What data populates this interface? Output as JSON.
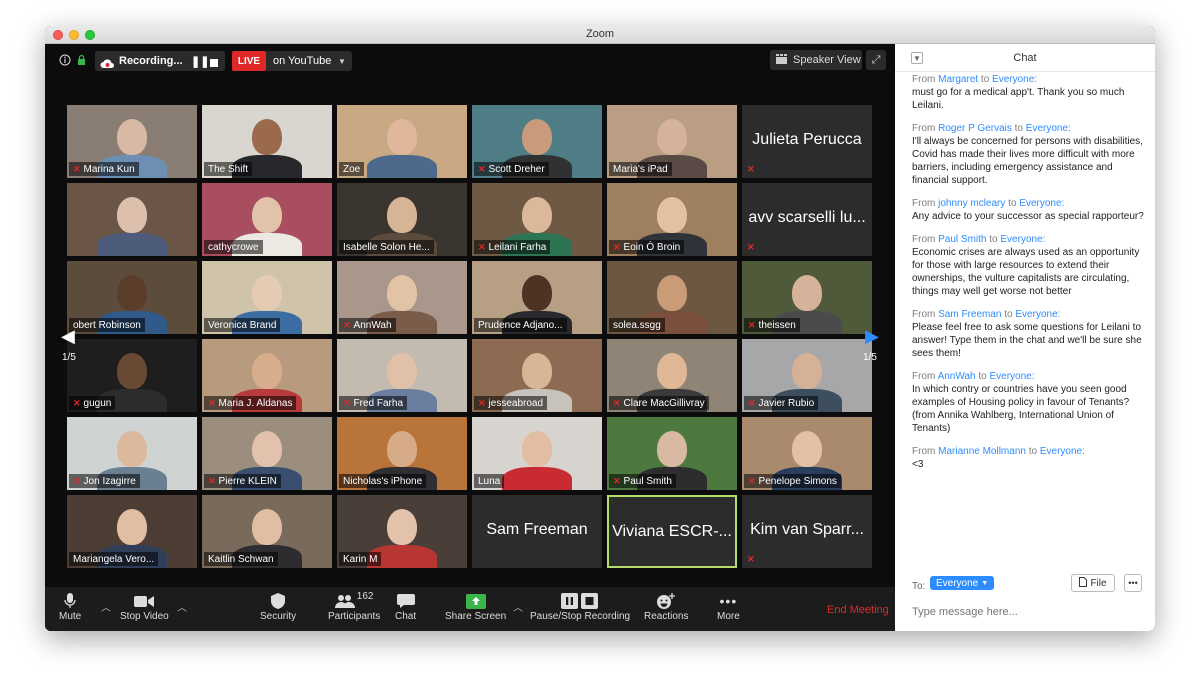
{
  "window": {
    "title": "Zoom"
  },
  "topbar": {
    "recording_label": "Recording...",
    "live_label": "LIVE",
    "youtube_label": "on YouTube",
    "speaker_view_label": "Speaker View"
  },
  "gallery": {
    "page_indicator_left": "1/5",
    "page_indicator_right": "1/5",
    "participants": [
      {
        "name": "Marina Kun",
        "muted": true,
        "video": true,
        "bg": "#8a7d74",
        "skin": "#d7b9a6",
        "shirt": "#6d8fb3"
      },
      {
        "name": "The Shift",
        "muted": false,
        "video": true,
        "bg": "#d9d6cf",
        "skin": "#9b6a4c",
        "shirt": "#27282b"
      },
      {
        "name": "Zoe",
        "muted": false,
        "video": true,
        "bg": "#c9a884",
        "skin": "#e0b79a",
        "shirt": "#4d6a8d"
      },
      {
        "name": "Scott Dreher",
        "muted": true,
        "video": true,
        "bg": "#4f7d86",
        "skin": "#c99b7b",
        "shirt": "#2f3133"
      },
      {
        "name": "Maria's iPad",
        "muted": false,
        "video": true,
        "bg": "#b99e84",
        "skin": "#d4b29b",
        "shirt": "#5a4a46"
      },
      {
        "name": "Julieta Perucca",
        "muted": true,
        "video": false
      },
      {
        "name": "",
        "muted": false,
        "video": true,
        "bg": "#6b5547",
        "skin": "#dcc0ad",
        "shirt": "#4c5c7a"
      },
      {
        "name": "cathycrowe",
        "muted": false,
        "video": true,
        "bg": "#a84e5e",
        "skin": "#e2c2a8",
        "shirt": "#ece8e2"
      },
      {
        "name": "Isabelle Solon He...",
        "muted": false,
        "video": true,
        "bg": "#3b3530",
        "skin": "#d6b597",
        "shirt": "#5b4b3c"
      },
      {
        "name": "Leilani Farha",
        "muted": true,
        "video": true,
        "bg": "#6e5a44",
        "skin": "#dcb89a",
        "shirt": "#2d7552"
      },
      {
        "name": "Eoin Ó Broin",
        "muted": true,
        "video": true,
        "bg": "#9e7f5e",
        "skin": "#e2c0a1",
        "shirt": "#30333a"
      },
      {
        "name": "avv scarselli lu...",
        "muted": true,
        "video": false
      },
      {
        "name": "obert Robinson",
        "muted": false,
        "video": true,
        "bg": "#5c4c3c",
        "skin": "#5a3d2b",
        "shirt": "#2f5a8a"
      },
      {
        "name": "Veronica Brand",
        "muted": false,
        "video": true,
        "bg": "#cfc3aa",
        "skin": "#e6cbb4",
        "shirt": "#3c6da2"
      },
      {
        "name": "AnnWah",
        "muted": true,
        "video": true,
        "bg": "#a8978a",
        "skin": "#e2c3a6",
        "shirt": "#7a5c4a"
      },
      {
        "name": "Prudence Adjano...",
        "muted": false,
        "video": true,
        "bg": "#b69f83",
        "skin": "#4c3324",
        "shirt": "#2a2a2e"
      },
      {
        "name": "solea.ssgg",
        "muted": false,
        "video": true,
        "bg": "#6c5842",
        "skin": "#c99b77",
        "shirt": "#7c4e3c"
      },
      {
        "name": "theissen",
        "muted": true,
        "video": true,
        "bg": "#4e5a3a",
        "skin": "#d7b29a",
        "shirt": "#4b4b4b"
      },
      {
        "name": "gugun",
        "muted": true,
        "video": true,
        "bg": "#1e1e1e",
        "skin": "#6b4a35",
        "shirt": "#2c2c2c"
      },
      {
        "name": "Maria J. Aldanas",
        "muted": true,
        "video": true,
        "bg": "#b89b7e",
        "skin": "#d8ad8c",
        "shirt": "#b93a3a"
      },
      {
        "name": "Fred Farha",
        "muted": true,
        "video": true,
        "bg": "#c4bbb0",
        "skin": "#e0c0a8",
        "shirt": "#6a7ea0"
      },
      {
        "name": "jesseabroad",
        "muted": true,
        "video": true,
        "bg": "#8d6b52",
        "skin": "#d9b597",
        "shirt": "#c7c2bb"
      },
      {
        "name": "Clare MacGillivray",
        "muted": true,
        "video": true,
        "bg": "#8f8476",
        "skin": "#e0b895",
        "shirt": "#3a3a3a"
      },
      {
        "name": "Javier Rubio",
        "muted": true,
        "video": true,
        "bg": "#a7a7a9",
        "skin": "#d5b197",
        "shirt": "#3d4e5f"
      },
      {
        "name": "Jon Izagirre",
        "muted": true,
        "video": true,
        "bg": "#cfd3d1",
        "skin": "#dcb89d",
        "shirt": "#6a7f92"
      },
      {
        "name": "Pierre KLEIN",
        "muted": true,
        "video": true,
        "bg": "#9b8e7e",
        "skin": "#e2c2ac",
        "shirt": "#3a4f70"
      },
      {
        "name": "Nicholas's iPhone",
        "muted": false,
        "video": true,
        "bg": "#b9743a",
        "skin": "#d8ab88",
        "shirt": "#2f2f33"
      },
      {
        "name": "Luna",
        "muted": false,
        "video": true,
        "bg": "#d7d4d0",
        "skin": "#e2bda4",
        "shirt": "#c92b33"
      },
      {
        "name": "Paul Smith",
        "muted": true,
        "video": true,
        "bg": "#4c7a3e",
        "skin": "#d9b9a1",
        "shirt": "#2d2d2f"
      },
      {
        "name": "Penelope Simons",
        "muted": true,
        "video": true,
        "bg": "#a98a6c",
        "skin": "#e3c1a4",
        "shirt": "#2a3e5e"
      },
      {
        "name": "Mariangela Vero...",
        "muted": false,
        "video": true,
        "bg": "#4d3e35",
        "skin": "#dfbea4",
        "shirt": "#2f3f5a"
      },
      {
        "name": "Kaitlin Schwan",
        "muted": false,
        "video": true,
        "bg": "#7a6a5c",
        "skin": "#e0bea4",
        "shirt": "#2d2d30"
      },
      {
        "name": "Karin M",
        "muted": false,
        "video": true,
        "bg": "#4a3f38",
        "skin": "#e2c2aa",
        "shirt": "#b83632"
      },
      {
        "name": "Sam Freeman",
        "muted": false,
        "video": false
      },
      {
        "name": "Viviana ESCR-...",
        "muted": false,
        "video": false,
        "active": true
      },
      {
        "name": "Kim van Sparr...",
        "muted": true,
        "video": false
      }
    ]
  },
  "toolbar": {
    "mute_label": "Mute",
    "stop_video_label": "Stop Video",
    "security_label": "Security",
    "participants_label": "Participants",
    "participants_count": "162",
    "chat_label": "Chat",
    "share_screen_label": "Share Screen",
    "pause_stop_recording_label": "Pause/Stop Recording",
    "reactions_label": "Reactions",
    "more_label": "More",
    "end_meeting_label": "End Meeting"
  },
  "chat": {
    "title": "Chat",
    "messages": [
      {
        "from": "Margaret",
        "to": "Everyone:",
        "text": "must go for a medical app't.  Thank  you so much Leilani."
      },
      {
        "from": "Roger P Gervais",
        "to": "Everyone:",
        "text": "I'll always be concerned for persons with disabilities, Covid has made their lives more difficult with more barriers, including emergency assistance and financial support."
      },
      {
        "from": "johnny mcleary",
        "to": "Everyone:",
        "text": "Any advice to your successor as special rapporteur?"
      },
      {
        "from": "Paul Smith",
        "to": "Everyone:",
        "text": "Economic crises are always used as an opportunity for those with large resources to extend their ownerships, the vulture capitalists are circulating, things may well get worse not better"
      },
      {
        "from": "Sam Freeman",
        "to": "Everyone:",
        "text": "Please feel free to ask some questions for Leilani to answer! Type them in the chat and we'll be sure she sees them!"
      },
      {
        "from": "AnnWah",
        "to": "Everyone:",
        "text": "In which contry or countries have you seen good examples of Housing policy in favour of Tenants?  (from Annika Wahlberg, International Union of Tenants)"
      },
      {
        "from": "Marianne Mollmann",
        "to": "Everyone:",
        "text": "<3"
      }
    ],
    "from_word": "From",
    "to_word": "to",
    "to_label": "To:",
    "recipient": "Everyone",
    "file_label": "File",
    "input_placeholder": "Type message here..."
  }
}
